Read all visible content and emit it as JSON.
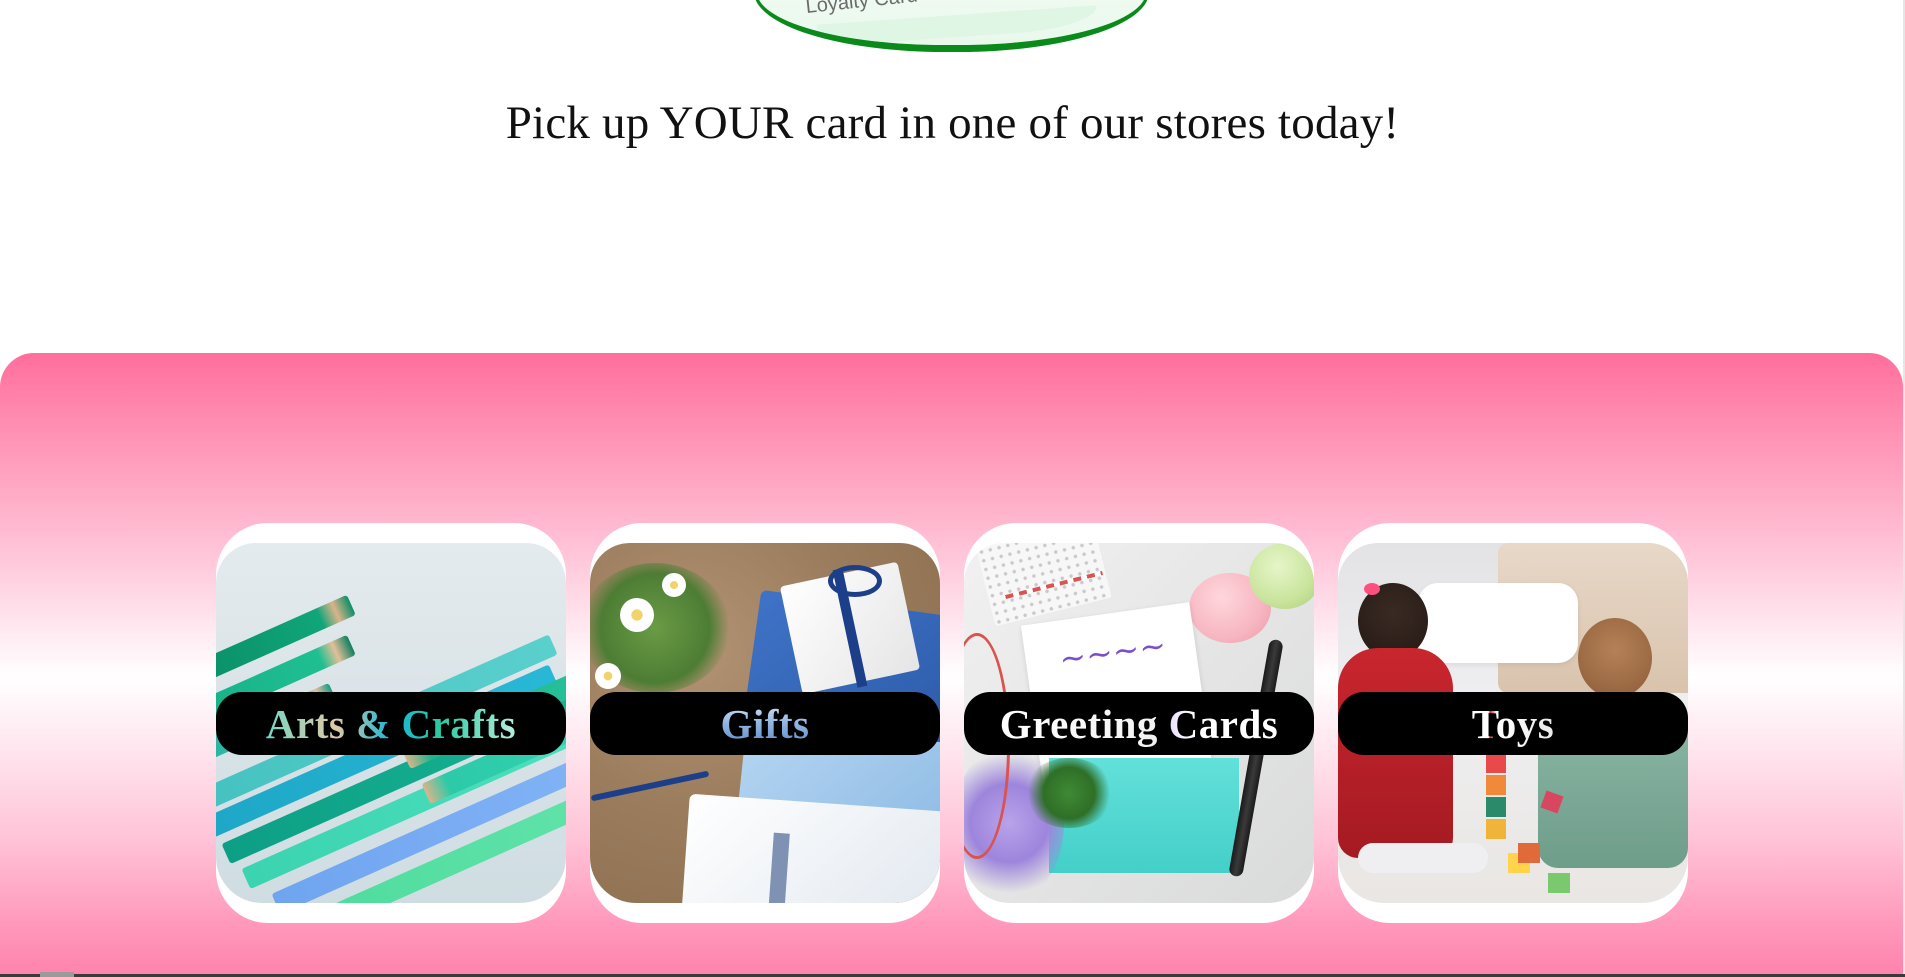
{
  "loyalty_card": {
    "label": "Loyalty Card"
  },
  "promo": {
    "text": "Pick up YOUR card in one of our stores today!"
  },
  "categories": [
    {
      "label": "Arts & Crafts",
      "image": "colored-pencils"
    },
    {
      "label": "Gifts",
      "image": "wrapped-gift-boxes"
    },
    {
      "label": "Greeting Cards",
      "image": "greeting-card-envelope"
    },
    {
      "label": "Toys",
      "image": "children-playing-blocks"
    }
  ],
  "colors": {
    "section_pink": "#ff6e9d",
    "card_green": "#0a8a1a",
    "label_band": "#000000"
  }
}
